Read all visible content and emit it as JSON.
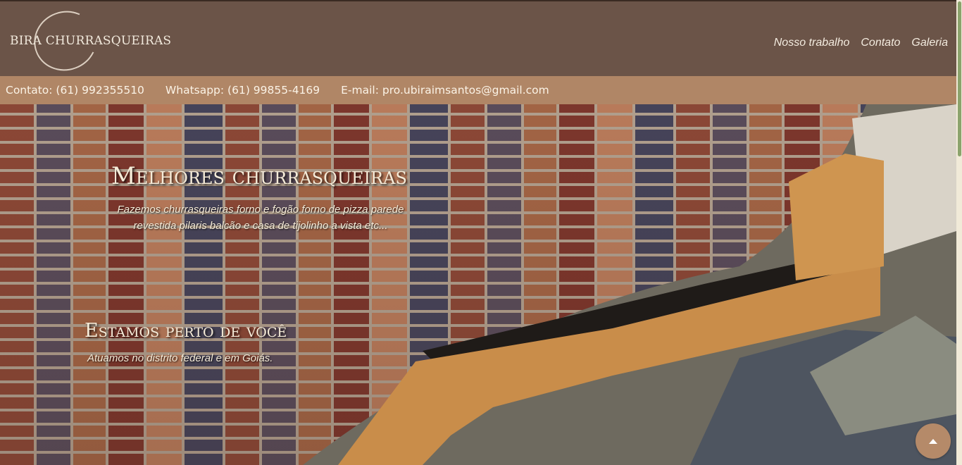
{
  "header": {
    "logo_text": "BIRA CHURRASQUEIRAS",
    "nav": [
      "Nosso trabalho",
      "Contato",
      "Galeria"
    ]
  },
  "contact_bar": {
    "phone": "Contato: (61) 992355510",
    "whatsapp": "Whatsapp: (61) 99855-4169",
    "email": "E-mail: pro.ubiraimsantos@gmail.com"
  },
  "hero": {
    "title": "Melhores churrasqueiras",
    "subtitle": "Fazemos churrasqueiras forno e fogão forno de pizza parede revestida pilaris balcão e casa de tijolinho a vista etc...",
    "title2": "Estamos perto de você",
    "subtitle2": "Atuamos no distrito federal e em Goiás."
  },
  "icons": {
    "back_to_top": "chevron-up-icon"
  },
  "colors": {
    "header_bg": "#6b5448",
    "contact_bar_bg": "#b08666",
    "back_to_top_bg": "#b58a69",
    "text_light": "#f5ebd8"
  }
}
